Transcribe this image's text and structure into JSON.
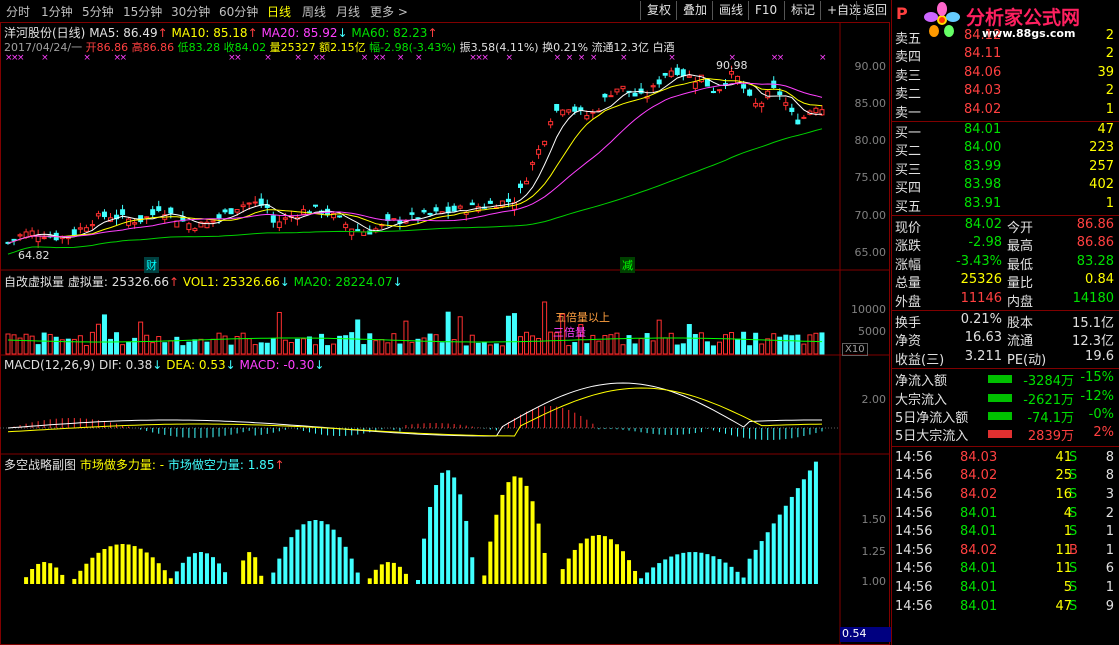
{
  "toolbar": {
    "tabs": [
      "分时",
      "1分钟",
      "5分钟",
      "15分钟",
      "30分钟",
      "60分钟",
      "日线",
      "周线",
      "月线",
      "更多 >"
    ],
    "active_tab": "日线",
    "buttons": [
      "复权",
      "叠加",
      "画线",
      "F10",
      "标记",
      "+自选",
      "返回"
    ]
  },
  "stock": {
    "name_line": "洋河股份(日线)",
    "ma5": "MA5: 86.49",
    "ma10": "MA10: 85.18",
    "ma20": "MA20: 85.92",
    "ma60": "MA60: 82.23",
    "info_date": "2017/04/24/一",
    "info_open": "开86.86",
    "info_high": "高86.86",
    "info_low": "低83.28",
    "info_close": "收84.02",
    "info_vol": "量25327",
    "info_amt": "额2.15亿",
    "info_chg": "幅-2.98(-3.43%)",
    "info_amp": "振3.58(4.11%)",
    "info_turn": "换0.21%",
    "info_float": "流通12.3亿",
    "info_ind": "白酒"
  },
  "price_axis": [
    "90.00",
    "85.00",
    "80.00",
    "75.00",
    "70.00",
    "65.00"
  ],
  "price_marks": {
    "high": "90.98",
    "low": "64.82",
    "cai": "财",
    "jian": "减"
  },
  "vol_panel": {
    "title": "自改虚拟量",
    "v1": "虚拟量: 25326.66",
    "v2": "VOL1: 25326.66",
    "v3": "MA20: 28224.07",
    "note1": "五倍量以上",
    "note2": "三倍量",
    "axis": [
      "10000",
      "5000"
    ],
    "unit": "X10"
  },
  "macd_panel": {
    "title": "MACD(12,26,9)",
    "dif": "DIF: 0.38",
    "dea": "DEA: 0.53",
    "macd": "MACD: -0.30",
    "axis": [
      "2.00"
    ]
  },
  "power_panel": {
    "title": "多空战略副图",
    "bull": "市场做多力量: -",
    "bear": "市场做空力量: 1.85",
    "axis": [
      "1.50",
      "1.25",
      "1.00"
    ],
    "cursor_value": "0.54"
  },
  "logo": {
    "title": "分析家公式网",
    "url": "www.88gs.com"
  },
  "panel_header": "P",
  "order_book": {
    "sell": [
      {
        "label": "卖五",
        "price": "84.12",
        "vol": "2"
      },
      {
        "label": "卖四",
        "price": "84.11",
        "vol": "2"
      },
      {
        "label": "卖三",
        "price": "84.06",
        "vol": "39"
      },
      {
        "label": "卖二",
        "price": "84.03",
        "vol": "2"
      },
      {
        "label": "卖一",
        "price": "84.02",
        "vol": "1"
      }
    ],
    "buy": [
      {
        "label": "买一",
        "price": "84.01",
        "vol": "47"
      },
      {
        "label": "买二",
        "price": "84.00",
        "vol": "223"
      },
      {
        "label": "买三",
        "price": "83.99",
        "vol": "257"
      },
      {
        "label": "买四",
        "price": "83.98",
        "vol": "402"
      },
      {
        "label": "买五",
        "price": "83.91",
        "vol": "1"
      }
    ]
  },
  "quote": [
    {
      "l1": "现价",
      "v1": "84.02",
      "l2": "今开",
      "v2": "86.86",
      "c1": "green",
      "c2": "red"
    },
    {
      "l1": "涨跌",
      "v1": "-2.98",
      "l2": "最高",
      "v2": "86.86",
      "c1": "green",
      "c2": "red"
    },
    {
      "l1": "涨幅",
      "v1": "-3.43%",
      "l2": "最低",
      "v2": "83.28",
      "c1": "green",
      "c2": "green"
    },
    {
      "l1": "总量",
      "v1": "25326",
      "l2": "量比",
      "v2": "0.84",
      "c1": "yellow",
      "c2": "yellow"
    },
    {
      "l1": "外盘",
      "v1": "11146",
      "l2": "内盘",
      "v2": "14180",
      "c1": "red",
      "c2": "green"
    }
  ],
  "stats": [
    {
      "l1": "换手",
      "v1": "0.21%",
      "l2": "股本",
      "v2": "15.1亿"
    },
    {
      "l1": "净资",
      "v1": "16.63",
      "l2": "流通",
      "v2": "12.3亿"
    },
    {
      "l1": "收益(三)",
      "v1": "3.211",
      "l2": "PE(动)",
      "v2": "19.6"
    }
  ],
  "flows": [
    {
      "label": "净流入额",
      "value": "-3284万",
      "pct": "-15%",
      "bar": "green"
    },
    {
      "label": "大宗流入",
      "value": "-2621万",
      "pct": "-12%",
      "bar": "green"
    },
    {
      "label": "5日净流入额",
      "value": "-74.1万",
      "pct": "-0%",
      "bar": "green"
    },
    {
      "label": "5日大宗流入",
      "value": "2839万",
      "pct": "2%",
      "bar": "red"
    }
  ],
  "ticks": [
    {
      "time": "14:56",
      "price": "84.03",
      "vol": "41",
      "side": "S",
      "n": "8"
    },
    {
      "time": "14:56",
      "price": "84.02",
      "vol": "25",
      "side": "S",
      "n": "8"
    },
    {
      "time": "14:56",
      "price": "84.02",
      "vol": "16",
      "side": "S",
      "n": "3"
    },
    {
      "time": "14:56",
      "price": "84.01",
      "vol": "4",
      "side": "S",
      "n": "2"
    },
    {
      "time": "14:56",
      "price": "84.01",
      "vol": "1",
      "side": "S",
      "n": "1"
    },
    {
      "time": "14:56",
      "price": "84.02",
      "vol": "11",
      "side": "B",
      "n": "1"
    },
    {
      "time": "14:56",
      "price": "84.01",
      "vol": "11",
      "side": "S",
      "n": "6"
    },
    {
      "time": "14:56",
      "price": "84.01",
      "vol": "5",
      "side": "S",
      "n": "1"
    },
    {
      "time": "14:56",
      "price": "84.01",
      "vol": "47",
      "side": "S",
      "n": "9"
    }
  ],
  "chart_data": {
    "type": "candlestick",
    "price_range": [
      64.5,
      91.5
    ],
    "high": 90.98,
    "low": 64.82,
    "last_close": 84.02
  }
}
